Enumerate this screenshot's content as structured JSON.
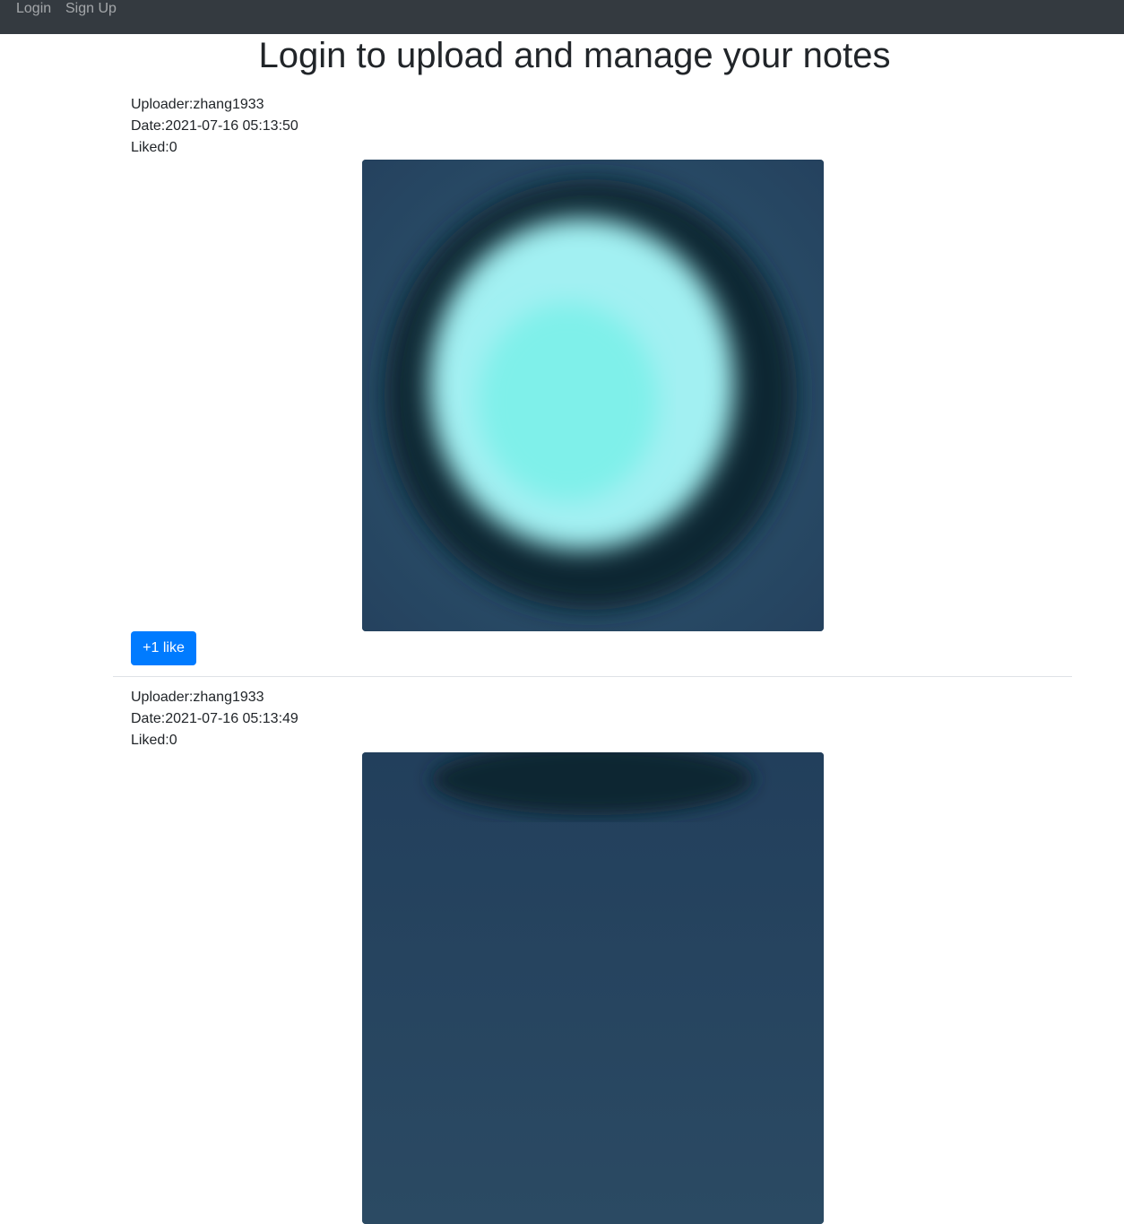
{
  "navbar": {
    "login_label": "Login",
    "signup_label": "Sign Up",
    "background": "#343a40"
  },
  "page": {
    "title": "Login to upload and manage your notes"
  },
  "posts": [
    {
      "uploader": "Uploader:zhang1933",
      "date": "Date:2021-07-16 05:13:50",
      "liked": "Liked:0",
      "like_button_label": "+1 like"
    },
    {
      "uploader": "Uploader:zhang1933",
      "date": "Date:2021-07-16 05:13:49",
      "liked": "Liked:0"
    }
  ],
  "colors": {
    "accent": "#007bff",
    "divider": "#dee2e6"
  }
}
